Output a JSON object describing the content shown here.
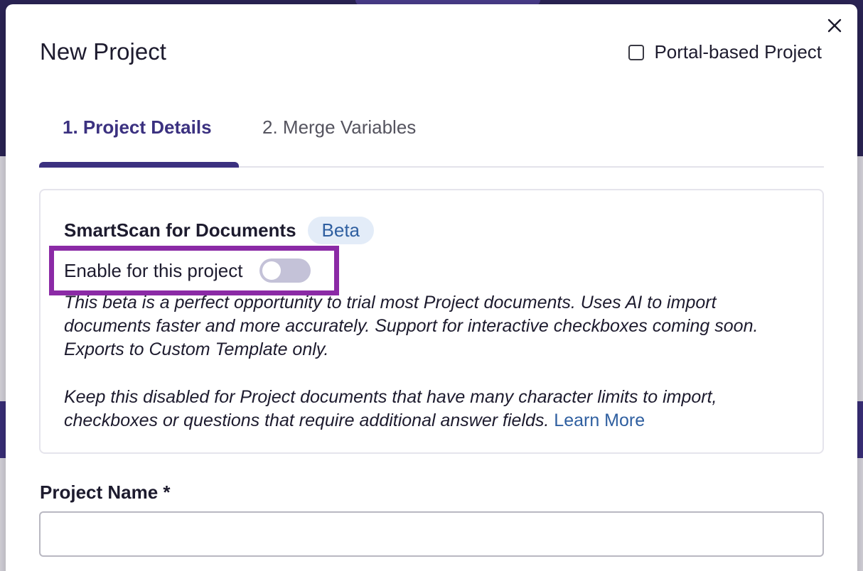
{
  "modal": {
    "title": "New Project",
    "portal_option": {
      "label": "Portal-based Project",
      "checked": false
    }
  },
  "tabs": [
    {
      "label": "1. Project Details",
      "active": true
    },
    {
      "label": "2. Merge Variables",
      "active": false
    }
  ],
  "smartscan": {
    "title": "SmartScan for Documents",
    "badge": "Beta",
    "toggle": {
      "label": "Enable for this project",
      "enabled": false
    },
    "description_1": "This beta is a perfect opportunity to trial most Project documents. Uses AI to import documents faster and more accurately. Support for interactive checkboxes coming soon. Exports to Custom Template only.",
    "description_2": "Keep this disabled for Project documents that have many character limits to import, checkboxes or questions that require additional answer fields.",
    "learn_more": "Learn More"
  },
  "project_name": {
    "label": "Project Name *",
    "value": ""
  },
  "colors": {
    "accent": "#3b3180",
    "link": "#2f5fa0",
    "highlight": "#8b2aa6",
    "badge_bg": "#e3ecf8"
  }
}
